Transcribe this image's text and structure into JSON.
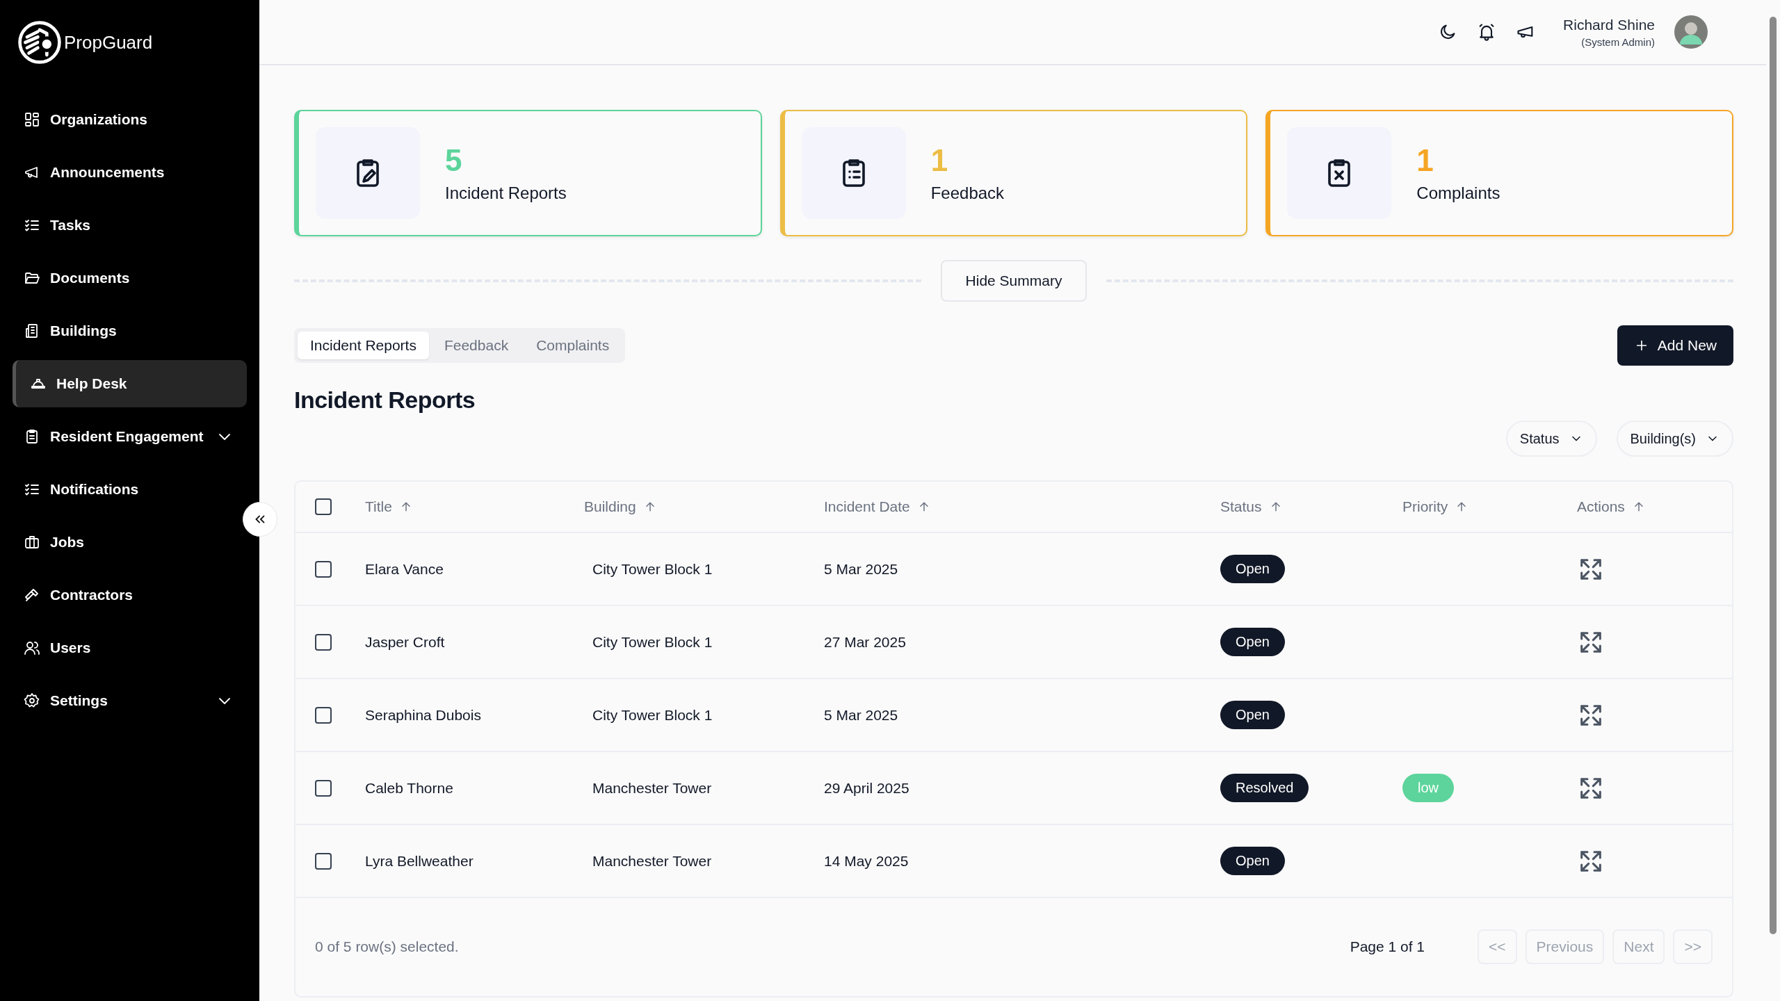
{
  "brand": {
    "name": "PropGuard"
  },
  "sidebar": {
    "items": [
      {
        "label": "Organizations",
        "selected": false,
        "kind": "link"
      },
      {
        "label": "Announcements",
        "selected": false,
        "kind": "link"
      },
      {
        "label": "Tasks",
        "selected": false,
        "kind": "link"
      },
      {
        "label": "Documents",
        "selected": false,
        "kind": "link"
      },
      {
        "label": "Buildings",
        "selected": false,
        "kind": "link"
      },
      {
        "label": "Help Desk",
        "selected": true,
        "kind": "link"
      },
      {
        "label": "Resident Engagement",
        "selected": false,
        "kind": "group"
      },
      {
        "label": "Notifications",
        "selected": false,
        "kind": "link"
      },
      {
        "label": "Jobs",
        "selected": false,
        "kind": "link"
      },
      {
        "label": "Contractors",
        "selected": false,
        "kind": "link"
      },
      {
        "label": "Users",
        "selected": false,
        "kind": "link"
      },
      {
        "label": "Settings",
        "selected": false,
        "kind": "group"
      }
    ]
  },
  "header": {
    "user_name": "Richard Shine",
    "user_role": "(System Admin)"
  },
  "summary_cards": [
    {
      "count": "5",
      "label": "Incident Reports",
      "color": "#5cd49b"
    },
    {
      "count": "1",
      "label": "Feedback",
      "color": "#ecbd45"
    },
    {
      "count": "1",
      "label": "Complaints",
      "color": "#f5a524"
    }
  ],
  "hide_summary_button": "Hide Summary",
  "tabs": [
    {
      "label": "Incident Reports",
      "selected": true
    },
    {
      "label": "Feedback",
      "selected": false
    },
    {
      "label": "Complaints",
      "selected": false
    }
  ],
  "add_button": "Add New",
  "section_title": "Incident Reports",
  "filters": [
    "Status",
    "Building(s)"
  ],
  "table": {
    "select_all_checked": false,
    "columns": [
      "Title",
      "Building",
      "Incident Date",
      "Status",
      "Priority",
      "Actions"
    ],
    "rows": [
      {
        "checked": false,
        "title": "Elara Vance",
        "building": "City Tower Block 1",
        "date": "5 Mar 2025",
        "status": "Open"
      },
      {
        "checked": false,
        "title": "Jasper Croft",
        "building": "City Tower Block 1",
        "date": "27 Mar 2025",
        "status": "Open"
      },
      {
        "checked": false,
        "title": "Seraphina Dubois",
        "building": "City Tower Block 1",
        "date": "5 Mar 2025",
        "status": "Open"
      },
      {
        "checked": false,
        "title": "Caleb Thorne",
        "building": "Manchester Tower",
        "date": "29 April 2025",
        "status": "Resolved",
        "priority": {
          "label": "low",
          "color": "#5cd49b"
        }
      },
      {
        "checked": false,
        "title": "Lyra Bellweather",
        "building": "Manchester Tower",
        "date": "14 May 2025",
        "status": "Open"
      }
    ]
  },
  "footer": {
    "selection": "0 of 5 row(s) selected.",
    "page": "Page 1 of 1",
    "buttons": [
      {
        "label": "<<",
        "disabled": true
      },
      {
        "label": "Previous",
        "disabled": true
      },
      {
        "label": "Next",
        "disabled": true
      },
      {
        "label": ">>",
        "disabled": true
      }
    ]
  }
}
